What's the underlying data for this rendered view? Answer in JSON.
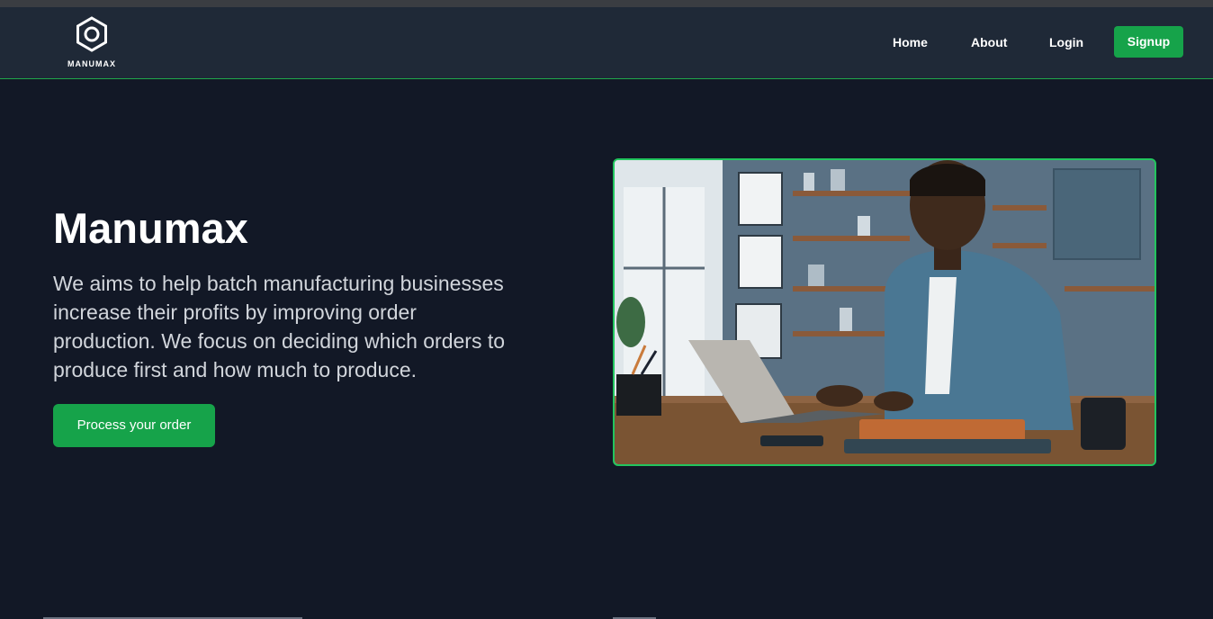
{
  "brand": {
    "name": "MANUMAX",
    "icon": "hexagon-ring-logo-icon"
  },
  "nav": {
    "home": "Home",
    "about": "About",
    "login": "Login",
    "signup": "Signup"
  },
  "hero": {
    "title": "Manumax",
    "description": "We aims to help batch manufacturing businesses increase their profits by improving order production. We focus on deciding which orders to produce first and how much to produce.",
    "cta": "Process your order",
    "image_alt": "Man working on laptop in office"
  },
  "colors": {
    "background": "#121826",
    "navbar": "#1f2937",
    "accent": "#16a34a",
    "image_border": "#22c55e"
  }
}
